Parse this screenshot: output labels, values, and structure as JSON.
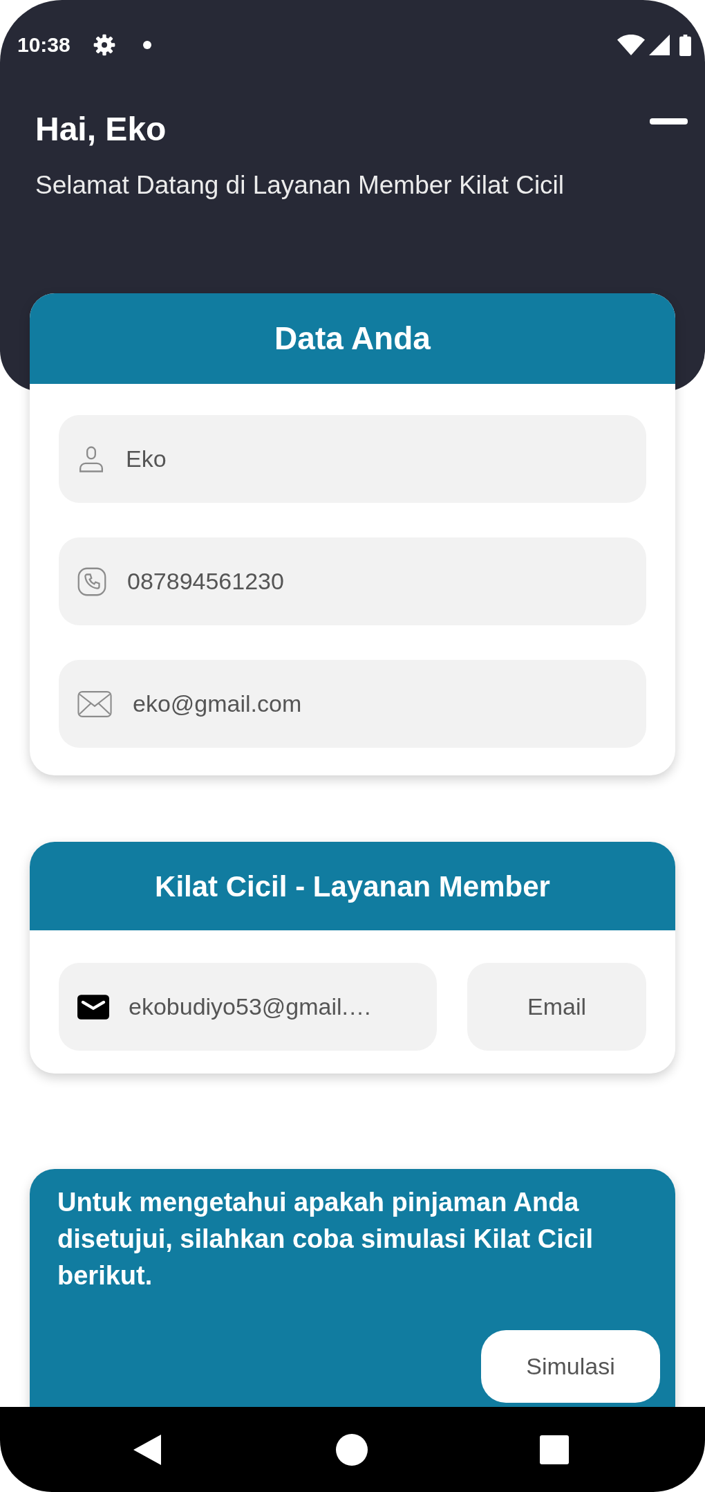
{
  "status_bar": {
    "time": "10:38"
  },
  "header": {
    "greeting": "Hai, Eko",
    "subtitle": "Selamat Datang di Layanan Member Kilat Cicil"
  },
  "data_card": {
    "title": "Data Anda",
    "fields": [
      {
        "kind": "name",
        "value": "Eko"
      },
      {
        "kind": "phone",
        "value": "087894561230"
      },
      {
        "kind": "email",
        "value": "eko@gmail.com"
      }
    ]
  },
  "member_card": {
    "title": "Kilat Cicil - Layanan Member",
    "contact": {
      "value": "ekobudiyo53@gmail.…"
    },
    "button": "Email"
  },
  "simulation_card": {
    "text": "Untuk mengetahui apakah pinjaman Anda disetujui, silahkan coba simulasi Kilat Cicil berikut.",
    "button": "Simulasi"
  }
}
